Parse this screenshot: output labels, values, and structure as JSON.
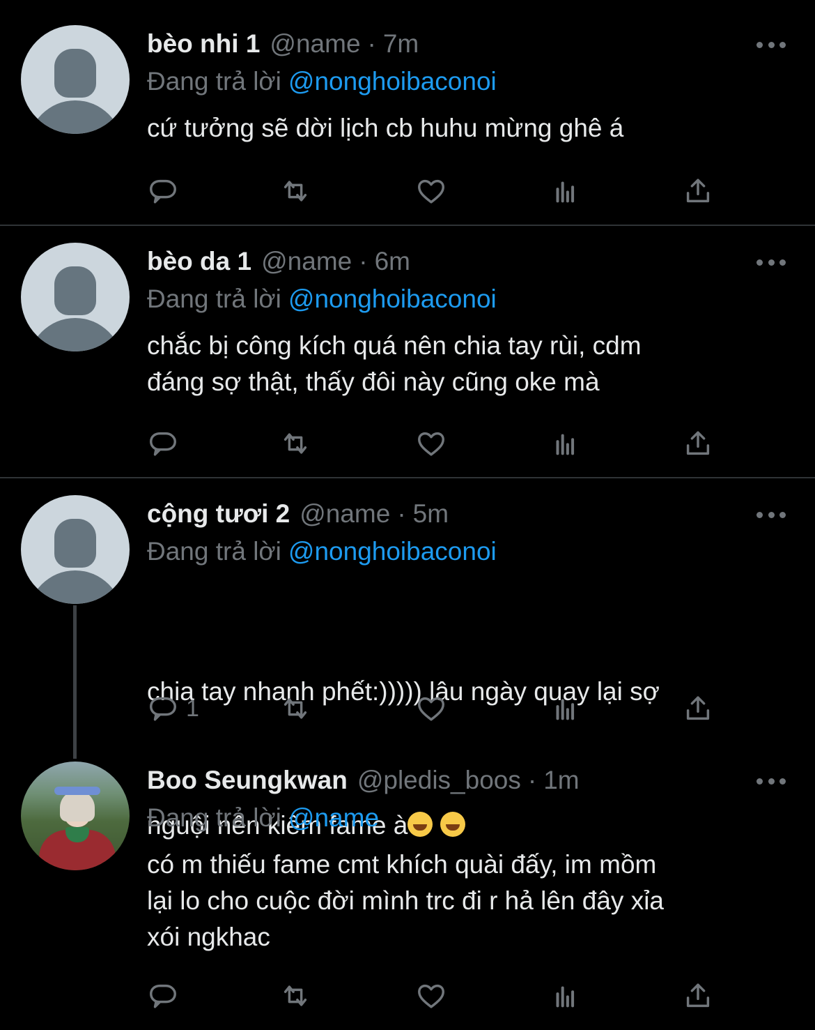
{
  "colors": {
    "background": "#000000",
    "text": "#e7e9ea",
    "muted": "#71767b",
    "accent": "#1d9bf0",
    "divider": "#2f3336"
  },
  "reply_prefix": "Đang trả lời",
  "tweets": [
    {
      "name": "bèo nhi 1",
      "handle": "@name",
      "time": "7m",
      "separator": "·",
      "reply_to": "@nonghoibaconoi",
      "text": "cứ tưởng sẽ dời lịch cb huhu mừng ghê á",
      "reply_count": "",
      "avatar": "default-avatar"
    },
    {
      "name": "bèo da 1",
      "handle": "@name",
      "time": "6m",
      "separator": "·",
      "reply_to": "@nonghoibaconoi",
      "text": "chắc bị công kích quá nên chia tay rùi, cdm\nđáng sợ thật, thấy đôi này cũng oke mà",
      "reply_count": "",
      "avatar": "default-avatar"
    },
    {
      "name": "cộng tươi 2",
      "handle": "@name",
      "time": "5m",
      "separator": "·",
      "reply_to": "@nonghoibaconoi",
      "text_line1": "chia tay nhanh phết:))))) lâu ngày quay lại sợ",
      "text_line2": "nguội nên kiếm fame à",
      "emoji": "rolling-on-floor-laughing-emoji",
      "reply_count": "1",
      "avatar": "default-avatar"
    },
    {
      "name": "Boo Seungkwan",
      "handle": "@pledis_boos",
      "time": "1m",
      "separator": "·",
      "reply_to": "@name",
      "text": "có m thiếu fame cmt khích quài đấy, im mồm\nlại lo cho cuộc đời mình trc đi r hả lên đây xỉa\nxói ngkhac",
      "reply_count": "",
      "avatar": "profile-photo"
    }
  ],
  "action_icons": [
    "reply-icon",
    "retweet-icon",
    "like-icon",
    "analytics-icon",
    "share-icon"
  ]
}
